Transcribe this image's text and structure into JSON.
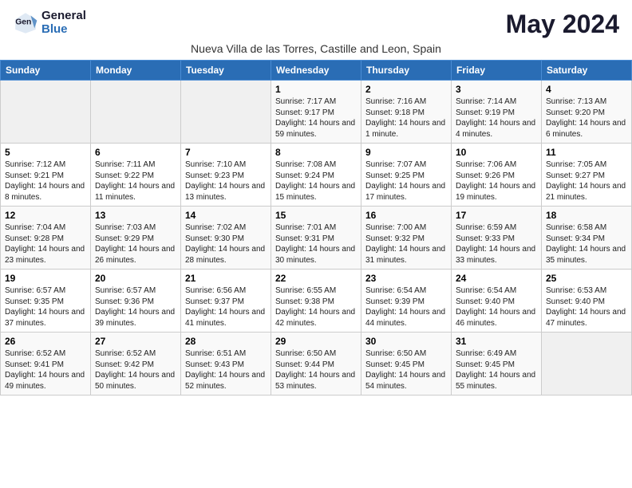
{
  "header": {
    "logo_general": "General",
    "logo_blue": "Blue",
    "month_title": "May 2024",
    "subtitle": "Nueva Villa de las Torres, Castille and Leon, Spain"
  },
  "days_of_week": [
    "Sunday",
    "Monday",
    "Tuesday",
    "Wednesday",
    "Thursday",
    "Friday",
    "Saturday"
  ],
  "weeks": [
    [
      {
        "day": "",
        "sunrise": "",
        "sunset": "",
        "daylight": "",
        "empty": true
      },
      {
        "day": "",
        "sunrise": "",
        "sunset": "",
        "daylight": "",
        "empty": true
      },
      {
        "day": "",
        "sunrise": "",
        "sunset": "",
        "daylight": "",
        "empty": true
      },
      {
        "day": "1",
        "sunrise": "Sunrise: 7:17 AM",
        "sunset": "Sunset: 9:17 PM",
        "daylight": "Daylight: 14 hours and 59 minutes.",
        "empty": false
      },
      {
        "day": "2",
        "sunrise": "Sunrise: 7:16 AM",
        "sunset": "Sunset: 9:18 PM",
        "daylight": "Daylight: 14 hours and 1 minute.",
        "empty": false
      },
      {
        "day": "3",
        "sunrise": "Sunrise: 7:14 AM",
        "sunset": "Sunset: 9:19 PM",
        "daylight": "Daylight: 14 hours and 4 minutes.",
        "empty": false
      },
      {
        "day": "4",
        "sunrise": "Sunrise: 7:13 AM",
        "sunset": "Sunset: 9:20 PM",
        "daylight": "Daylight: 14 hours and 6 minutes.",
        "empty": false
      }
    ],
    [
      {
        "day": "5",
        "sunrise": "Sunrise: 7:12 AM",
        "sunset": "Sunset: 9:21 PM",
        "daylight": "Daylight: 14 hours and 8 minutes.",
        "empty": false
      },
      {
        "day": "6",
        "sunrise": "Sunrise: 7:11 AM",
        "sunset": "Sunset: 9:22 PM",
        "daylight": "Daylight: 14 hours and 11 minutes.",
        "empty": false
      },
      {
        "day": "7",
        "sunrise": "Sunrise: 7:10 AM",
        "sunset": "Sunset: 9:23 PM",
        "daylight": "Daylight: 14 hours and 13 minutes.",
        "empty": false
      },
      {
        "day": "8",
        "sunrise": "Sunrise: 7:08 AM",
        "sunset": "Sunset: 9:24 PM",
        "daylight": "Daylight: 14 hours and 15 minutes.",
        "empty": false
      },
      {
        "day": "9",
        "sunrise": "Sunrise: 7:07 AM",
        "sunset": "Sunset: 9:25 PM",
        "daylight": "Daylight: 14 hours and 17 minutes.",
        "empty": false
      },
      {
        "day": "10",
        "sunrise": "Sunrise: 7:06 AM",
        "sunset": "Sunset: 9:26 PM",
        "daylight": "Daylight: 14 hours and 19 minutes.",
        "empty": false
      },
      {
        "day": "11",
        "sunrise": "Sunrise: 7:05 AM",
        "sunset": "Sunset: 9:27 PM",
        "daylight": "Daylight: 14 hours and 21 minutes.",
        "empty": false
      }
    ],
    [
      {
        "day": "12",
        "sunrise": "Sunrise: 7:04 AM",
        "sunset": "Sunset: 9:28 PM",
        "daylight": "Daylight: 14 hours and 23 minutes.",
        "empty": false
      },
      {
        "day": "13",
        "sunrise": "Sunrise: 7:03 AM",
        "sunset": "Sunset: 9:29 PM",
        "daylight": "Daylight: 14 hours and 26 minutes.",
        "empty": false
      },
      {
        "day": "14",
        "sunrise": "Sunrise: 7:02 AM",
        "sunset": "Sunset: 9:30 PM",
        "daylight": "Daylight: 14 hours and 28 minutes.",
        "empty": false
      },
      {
        "day": "15",
        "sunrise": "Sunrise: 7:01 AM",
        "sunset": "Sunset: 9:31 PM",
        "daylight": "Daylight: 14 hours and 30 minutes.",
        "empty": false
      },
      {
        "day": "16",
        "sunrise": "Sunrise: 7:00 AM",
        "sunset": "Sunset: 9:32 PM",
        "daylight": "Daylight: 14 hours and 31 minutes.",
        "empty": false
      },
      {
        "day": "17",
        "sunrise": "Sunrise: 6:59 AM",
        "sunset": "Sunset: 9:33 PM",
        "daylight": "Daylight: 14 hours and 33 minutes.",
        "empty": false
      },
      {
        "day": "18",
        "sunrise": "Sunrise: 6:58 AM",
        "sunset": "Sunset: 9:34 PM",
        "daylight": "Daylight: 14 hours and 35 minutes.",
        "empty": false
      }
    ],
    [
      {
        "day": "19",
        "sunrise": "Sunrise: 6:57 AM",
        "sunset": "Sunset: 9:35 PM",
        "daylight": "Daylight: 14 hours and 37 minutes.",
        "empty": false
      },
      {
        "day": "20",
        "sunrise": "Sunrise: 6:57 AM",
        "sunset": "Sunset: 9:36 PM",
        "daylight": "Daylight: 14 hours and 39 minutes.",
        "empty": false
      },
      {
        "day": "21",
        "sunrise": "Sunrise: 6:56 AM",
        "sunset": "Sunset: 9:37 PM",
        "daylight": "Daylight: 14 hours and 41 minutes.",
        "empty": false
      },
      {
        "day": "22",
        "sunrise": "Sunrise: 6:55 AM",
        "sunset": "Sunset: 9:38 PM",
        "daylight": "Daylight: 14 hours and 42 minutes.",
        "empty": false
      },
      {
        "day": "23",
        "sunrise": "Sunrise: 6:54 AM",
        "sunset": "Sunset: 9:39 PM",
        "daylight": "Daylight: 14 hours and 44 minutes.",
        "empty": false
      },
      {
        "day": "24",
        "sunrise": "Sunrise: 6:54 AM",
        "sunset": "Sunset: 9:40 PM",
        "daylight": "Daylight: 14 hours and 46 minutes.",
        "empty": false
      },
      {
        "day": "25",
        "sunrise": "Sunrise: 6:53 AM",
        "sunset": "Sunset: 9:40 PM",
        "daylight": "Daylight: 14 hours and 47 minutes.",
        "empty": false
      }
    ],
    [
      {
        "day": "26",
        "sunrise": "Sunrise: 6:52 AM",
        "sunset": "Sunset: 9:41 PM",
        "daylight": "Daylight: 14 hours and 49 minutes.",
        "empty": false
      },
      {
        "day": "27",
        "sunrise": "Sunrise: 6:52 AM",
        "sunset": "Sunset: 9:42 PM",
        "daylight": "Daylight: 14 hours and 50 minutes.",
        "empty": false
      },
      {
        "day": "28",
        "sunrise": "Sunrise: 6:51 AM",
        "sunset": "Sunset: 9:43 PM",
        "daylight": "Daylight: 14 hours and 52 minutes.",
        "empty": false
      },
      {
        "day": "29",
        "sunrise": "Sunrise: 6:50 AM",
        "sunset": "Sunset: 9:44 PM",
        "daylight": "Daylight: 14 hours and 53 minutes.",
        "empty": false
      },
      {
        "day": "30",
        "sunrise": "Sunrise: 6:50 AM",
        "sunset": "Sunset: 9:45 PM",
        "daylight": "Daylight: 14 hours and 54 minutes.",
        "empty": false
      },
      {
        "day": "31",
        "sunrise": "Sunrise: 6:49 AM",
        "sunset": "Sunset: 9:45 PM",
        "daylight": "Daylight: 14 hours and 55 minutes.",
        "empty": false
      },
      {
        "day": "",
        "sunrise": "",
        "sunset": "",
        "daylight": "",
        "empty": true
      }
    ]
  ]
}
